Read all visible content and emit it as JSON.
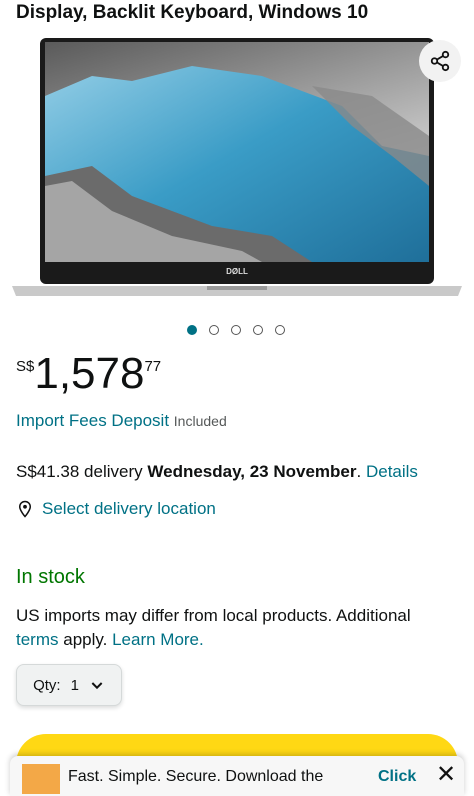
{
  "product": {
    "title_line": "Display, Backlit Keyboard, Windows 10",
    "brand_on_image": "DØLL"
  },
  "gallery": {
    "image_count": 5,
    "active_index": 0
  },
  "price": {
    "currency": "S$",
    "whole": "1,578",
    "fraction": "77"
  },
  "import_fees": {
    "label": "Import Fees Deposit",
    "status": "Included"
  },
  "delivery": {
    "cost": "S$41.38 delivery",
    "date": "Wednesday, 23 November",
    "details_link": "Details",
    "location_link": "Select delivery location"
  },
  "stock": {
    "status": "In stock"
  },
  "import_note": {
    "text1": "US imports may differ from local products. Additional",
    "terms_link": "terms",
    "text2": "apply.",
    "learn_more_link": "Learn More."
  },
  "quantity": {
    "label": "Qty:",
    "value": "1"
  },
  "app_banner": {
    "text": "Fast. Simple. Secure. Download the",
    "action": "Click"
  },
  "colors": {
    "link": "#007185",
    "in_stock": "#007600",
    "buy_button": "#ffd814",
    "active_dot": "#007185"
  },
  "icons": {
    "share": "share-icon",
    "location": "location-pin-icon",
    "chevron": "chevron-down-icon",
    "close": "close-icon"
  }
}
